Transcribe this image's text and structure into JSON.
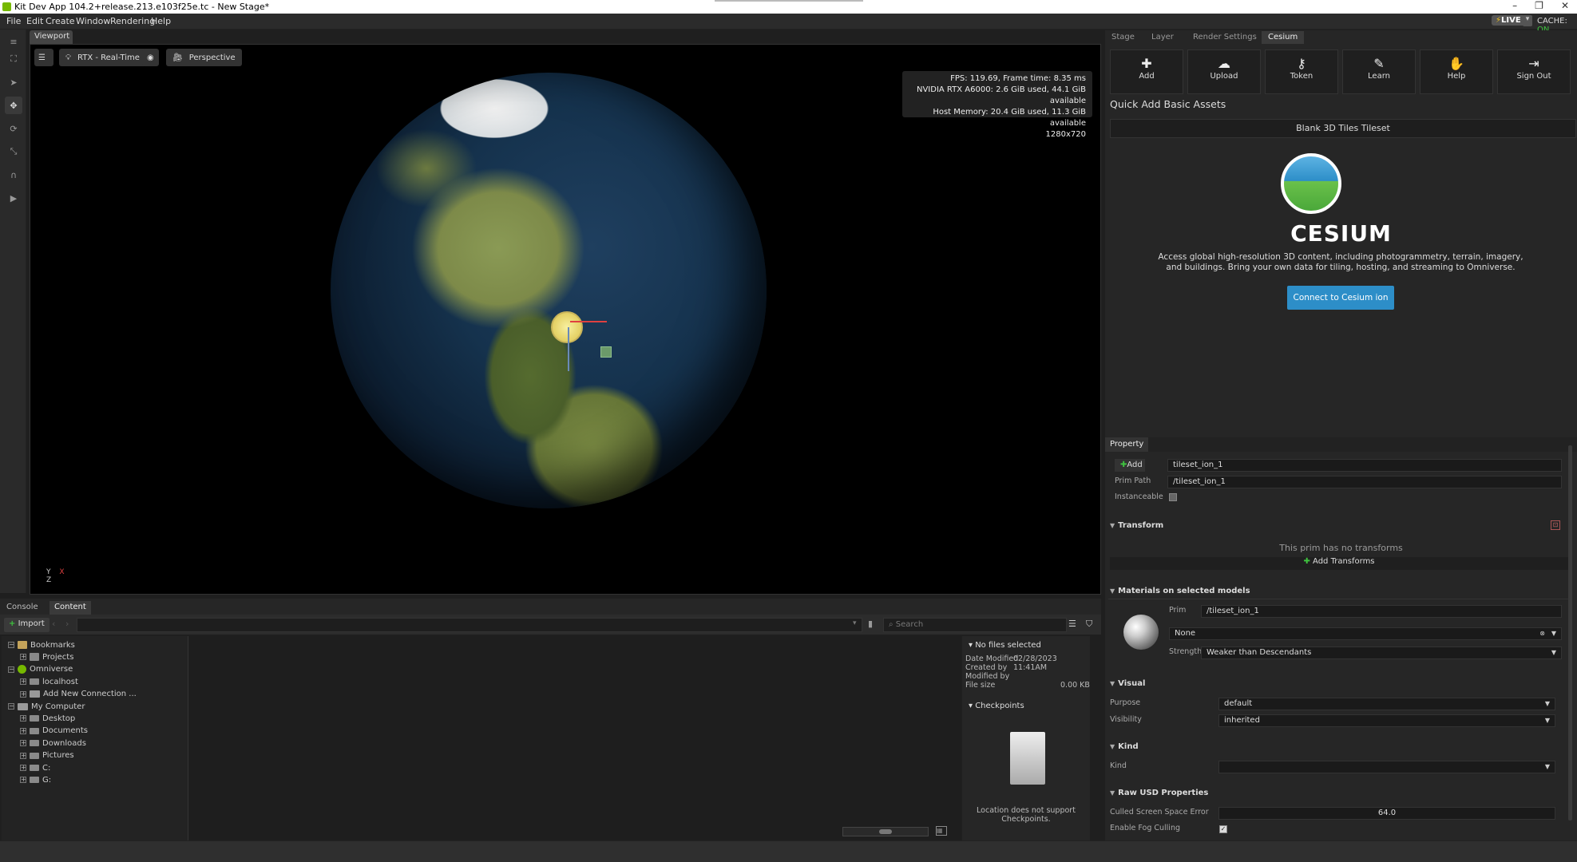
{
  "window": {
    "title": "Kit Dev App 104.2+release.213.e103f25e.tc - New Stage*",
    "controls": [
      "–",
      "❐",
      "✕"
    ]
  },
  "menu": {
    "items": [
      "File",
      "Edit",
      "Create",
      "Window",
      "Rendering",
      "Help"
    ],
    "live_label": "LIVE",
    "cache_label": "CACHE:",
    "cache_status": "ON",
    "cache_color": "#3fc33f"
  },
  "viewport": {
    "tab_label": "Viewport",
    "render_mode": "RTX - Real-Time",
    "camera": "Perspective",
    "stats": [
      "FPS: 119.69, Frame time: 8.35 ms",
      "NVIDIA RTX A6000: 2.6 GiB used, 44.1 GiB available",
      "Host Memory: 20.4 GiB used, 11.3 GiB available",
      "1280x720"
    ],
    "axis_x": "X",
    "axis_y": "Y",
    "axis_z": "Z"
  },
  "bottom_panel": {
    "tabs": [
      "Console",
      "Content"
    ],
    "active_tab": "Content",
    "import_label": "Import",
    "search_placeholder": "Search",
    "tree": [
      {
        "label": "Bookmarks",
        "level": 0,
        "expander": "−",
        "icon": "bookmark-icon"
      },
      {
        "label": "Projects",
        "level": 1,
        "expander": "+",
        "icon": "folder-icon"
      },
      {
        "label": "Omniverse",
        "level": 0,
        "expander": "−",
        "icon": "omniverse-icon"
      },
      {
        "label": "localhost",
        "level": 1,
        "expander": "+",
        "icon": "server-icon"
      },
      {
        "label": "Add New Connection ...",
        "level": 1,
        "expander": "+",
        "icon": "connection-icon"
      },
      {
        "label": "My Computer",
        "level": 0,
        "expander": "−",
        "icon": "computer-icon"
      },
      {
        "label": "Desktop",
        "level": 1,
        "expander": "+",
        "icon": "drive-icon"
      },
      {
        "label": "Documents",
        "level": 1,
        "expander": "+",
        "icon": "drive-icon"
      },
      {
        "label": "Downloads",
        "level": 1,
        "expander": "+",
        "icon": "drive-icon"
      },
      {
        "label": "Pictures",
        "level": 1,
        "expander": "+",
        "icon": "drive-icon"
      },
      {
        "label": "C:",
        "level": 1,
        "expander": "+",
        "icon": "drive-icon"
      },
      {
        "label": "G:",
        "level": 1,
        "expander": "+",
        "icon": "drive-icon"
      }
    ],
    "details": {
      "no_files": "No files selected",
      "date_modified_label": "Date Modified",
      "date_modified_value": "02/28/2023 11:41AM",
      "created_by_label": "Created by",
      "modified_by_label": "Modified by",
      "file_size_label": "File size",
      "file_size_value": "0.00 KB",
      "checkpoints_label": "Checkpoints",
      "checkpoints_msg": "Location does not support Checkpoints."
    }
  },
  "right_panel": {
    "tabs": [
      "Stage",
      "Layer",
      "Render Settings",
      "Cesium"
    ],
    "active_tab": "Cesium",
    "cesium_buttons": [
      {
        "label": "Add",
        "icon": "plus-icon"
      },
      {
        "label": "Upload",
        "icon": "cloud-upload-icon"
      },
      {
        "label": "Token",
        "icon": "key-icon"
      },
      {
        "label": "Learn",
        "icon": "learn-icon"
      },
      {
        "label": "Help",
        "icon": "handshake-icon"
      },
      {
        "label": "Sign Out",
        "icon": "sign-out-icon"
      }
    ],
    "quick_add_title": "Quick Add Basic Assets",
    "blank_tileset": "Blank 3D Tiles Tileset",
    "cesium_wordmark": "CESIUM",
    "cesium_desc": "Access global high-resolution 3D content, including photogrammetry, terrain, imagery, and buildings. Bring your own data for tiling, hosting, and streaming to Omniverse.",
    "connect_label": "Connect to Cesium ion",
    "accent": "#2d8ec8"
  },
  "property": {
    "tab_label": "Property",
    "add_label": "Add",
    "prim_name": "tileset_ion_1",
    "prim_path_label": "Prim Path",
    "prim_path": "/tileset_ion_1",
    "instanceable_label": "Instanceable",
    "transform_header": "Transform",
    "no_transforms": "This prim has no transforms",
    "add_transforms": "Add Transforms",
    "materials_header": "Materials on selected models",
    "prim_label": "Prim",
    "material_prim": "/tileset_ion_1",
    "material_value": "None",
    "strength_label": "Strength",
    "strength_value": "Weaker than Descendants",
    "visual_header": "Visual",
    "purpose_label": "Purpose",
    "purpose_value": "default",
    "visibility_label": "Visibility",
    "visibility_value": "inherited",
    "kind_header": "Kind",
    "kind_label": "Kind",
    "kind_value": "",
    "raw_header": "Raw USD Properties",
    "culled_label": "Culled Screen Space Error",
    "culled_value": "64.0",
    "fog_label": "Enable Fog Culling"
  }
}
